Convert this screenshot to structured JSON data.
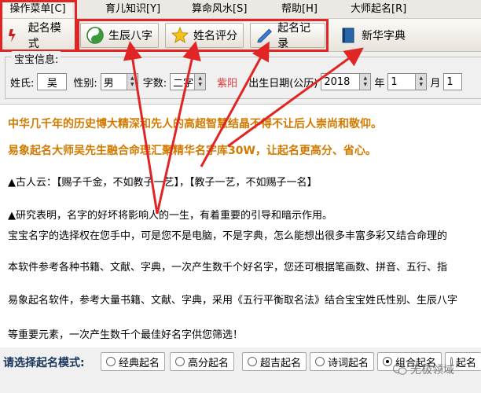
{
  "menu": {
    "items": [
      "操作菜单[C]",
      "育儿知识[Y]",
      "算命风水[S]",
      "帮助[H]",
      "大师起名[R]"
    ]
  },
  "toolbar": {
    "naming_mode": "起名模式",
    "birth_chart": "生辰八字",
    "name_score": "姓名评分",
    "name_records": "起名记录",
    "xinhua_dict": "新华字典"
  },
  "baby_info": {
    "title": "宝宝信息:",
    "surname_label": "姓氏:",
    "surname_value": "吴",
    "gender_label": "性别:",
    "gender_value": "男",
    "chars_label": "字数:",
    "chars_value": "二字",
    "ziling_label": "紫阳",
    "birthdate_label": "出生日期(公历)",
    "year_value": "2018",
    "year_unit": "年",
    "month_value": "1",
    "month_unit": "月",
    "day_value": "1"
  },
  "content": {
    "headline1": "中华几千年的历史博大精深和先人的高超智慧结晶不得不让后人崇尚和敬仰。",
    "headline2": "易象起名大师吴先生融合命理汇聚精华名字库30W，让起名更高分、省心。",
    "p1": "▲古人云：【赐子千金，不如教子一艺】，【教子一艺，不如赐子一名】",
    "p2": "▲研究表明，名字的好坏将影响人的一生，有着重要的引导和暗示作用。",
    "p3": "宝宝名字的选择权在您手中，可是您不是电脑，不是字典，怎么能想出很多丰富多彩又结合命理的",
    "p4": "本软件参考各种书籍、文献、字典，一次产生数千个好名字，您还可根据笔画数、拼音、五行、指",
    "p5": "易象起名软件，参考大量书籍、文献、字典，采用《五行平衡取名法》结合宝宝姓氏性别、生辰八字",
    "p6": "等重要元素，一次产生数千个最佳好名字供您筛选！"
  },
  "mode_bar": {
    "label": "请选择起名模式:",
    "options": [
      "经典起名",
      "高分起名",
      "超吉起名",
      "诗词起名",
      "组合起名",
      "起名"
    ],
    "selected": "组合起名"
  },
  "watermark": "无极领域",
  "colors": {
    "highlight_red": "#e12424",
    "headline_orange": "#d27a00"
  }
}
